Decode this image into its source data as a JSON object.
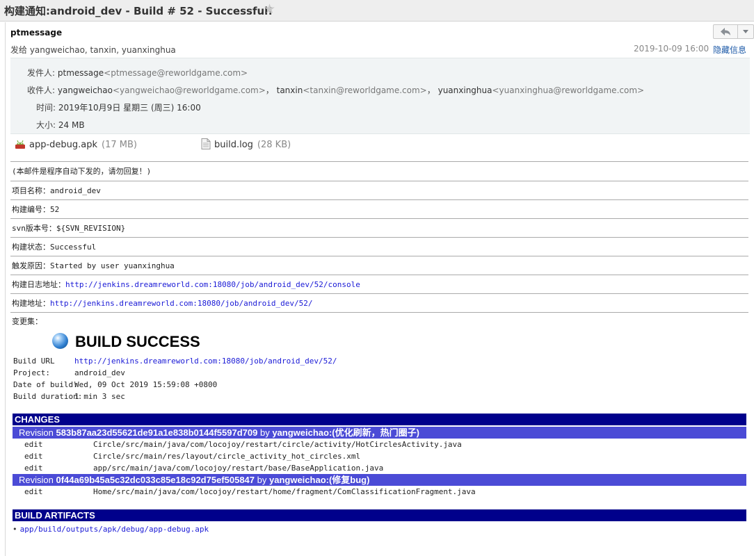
{
  "window": {
    "title": "构建通知:android_dev - Build # 52 - Successful!"
  },
  "header": {
    "sender": "ptmessage",
    "recipients": "发给 yangweichao, tanxin, yuanxinghua",
    "datetime": "2019-10-09 16:00",
    "hide_label": "隐藏信息"
  },
  "details": {
    "from_label": "发件人:",
    "from_name": "ptmessage",
    "from_addr": "<ptmessage@reworldgame.com>",
    "to_label": "收件人:",
    "to": [
      {
        "name": "yangweichao",
        "addr": "<yangweichao@reworldgame.com>",
        "sep": "，"
      },
      {
        "name": "tanxin",
        "addr": "<tanxin@reworldgame.com>",
        "sep": "，"
      },
      {
        "name": "yuanxinghua",
        "addr": "<yuanxinghua@reworldgame.com>",
        "sep": ""
      }
    ],
    "time_label": "时间:",
    "time_value": "2019年10月9日 星期三 (周三) 16:00",
    "size_label": "大小:",
    "size_value": "24 MB"
  },
  "attachments": [
    {
      "name": "app-debug.apk",
      "size": "(17 MB)",
      "icon": "apk-file-icon"
    },
    {
      "name": "build.log",
      "size": "(28 KB)",
      "icon": "document-file-icon"
    }
  ],
  "body": {
    "notice": "(本邮件是程序自动下发的，请勿回复！)",
    "project_label": "项目名称：",
    "project_value": "android_dev",
    "build_no_label": "构建编号：",
    "build_no_value": "52",
    "svn_label": "svn版本号：",
    "svn_value": "${SVN_REVISION}",
    "status_label": "构建状态：",
    "status_value": "Successful",
    "cause_label": "触发原因：",
    "cause_value": "Started by user yuanxinghua",
    "log_label": "构建日志地址：",
    "log_url": "http://jenkins.dreamreworld.com:18080/job/android_dev/52/console",
    "build_url_label": "构建地址：",
    "build_url": "http://jenkins.dreamreworld.com:18080/job/android_dev/52/",
    "changeset_label": "变更集："
  },
  "report": {
    "title": "BUILD SUCCESS",
    "facts": [
      {
        "key": "Build URL",
        "value": "http://jenkins.dreamreworld.com:18080/job/android_dev/52/",
        "link": true
      },
      {
        "key": "Project:",
        "value": "android_dev",
        "link": false
      },
      {
        "key": "Date of build:",
        "value": "Wed, 09 Oct 2019 15:59:08 +0800",
        "link": false
      },
      {
        "key": "Build duration:",
        "value": "1 min 3 sec",
        "link": false
      }
    ],
    "changes_title": "CHANGES",
    "revisions": [
      {
        "prefix": "Revision",
        "hash": "583b87aa23d55621de91a1e838b0144f5597d709",
        "by": "by",
        "author": "yangweichao:(优化刷新，热门圈子)",
        "files": [
          {
            "action": "edit",
            "path": "Circle/src/main/java/com/locojoy/restart/circle/activity/HotCirclesActivity.java"
          },
          {
            "action": "edit",
            "path": "Circle/src/main/res/layout/circle_activity_hot_circles.xml"
          },
          {
            "action": "edit",
            "path": "app/src/main/java/com/locojoy/restart/base/BaseApplication.java"
          }
        ]
      },
      {
        "prefix": "Revision",
        "hash": "0f44a69b45a5c32dc033c85e18c92d75ef505847",
        "by": "by",
        "author": "yangweichao:(修复bug)",
        "files": [
          {
            "action": "edit",
            "path": "Home/src/main/java/com/locojoy/restart/home/fragment/ComClassificationFragment.java"
          }
        ]
      }
    ],
    "artifacts_title": "BUILD ARTIFACTS",
    "artifacts": [
      "app/build/outputs/apk/debug/app-debug.apk"
    ]
  },
  "colors": {
    "section_bar": "#00008b",
    "revision_bar": "#4b4bd6",
    "link": "#1a1ad6",
    "details_bg": "#f1f4f5"
  }
}
